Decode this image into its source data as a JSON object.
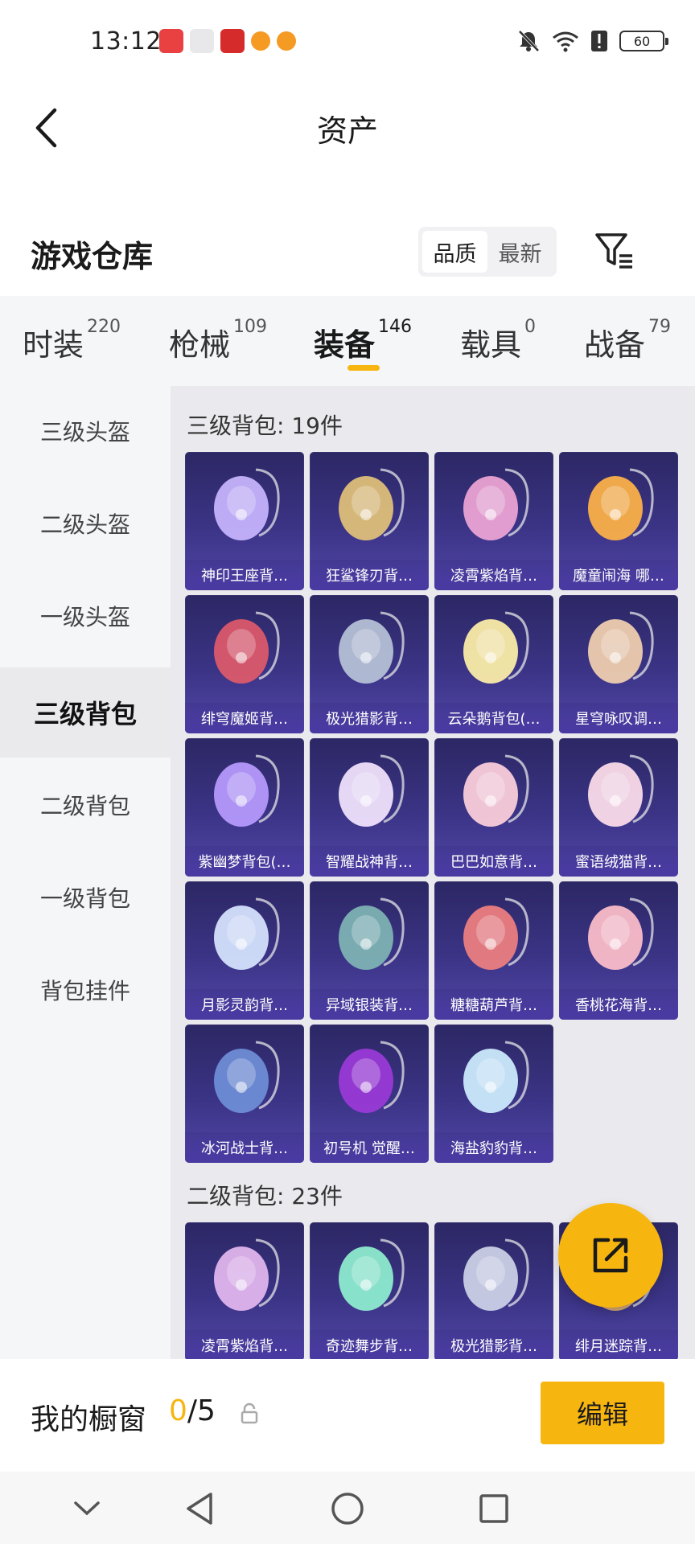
{
  "status_bar": {
    "time": "13:12",
    "battery": "60"
  },
  "header": {
    "title": "资产"
  },
  "warehouse": {
    "title": "游戏仓库",
    "sort_options": [
      {
        "label": "品质",
        "active": true
      },
      {
        "label": "最新",
        "active": false
      }
    ]
  },
  "tabs": [
    {
      "label": "时装",
      "count": "220",
      "active": false
    },
    {
      "label": "枪械",
      "count": "109",
      "active": false
    },
    {
      "label": "装备",
      "count": "146",
      "active": true
    },
    {
      "label": "载具",
      "count": "0",
      "active": false
    },
    {
      "label": "战备",
      "count": "79",
      "active": false
    }
  ],
  "sidebar": {
    "items": [
      {
        "label": "三级头盔",
        "active": false
      },
      {
        "label": "二级头盔",
        "active": false
      },
      {
        "label": "一级头盔",
        "active": false
      },
      {
        "label": "三级背包",
        "active": true
      },
      {
        "label": "二级背包",
        "active": false
      },
      {
        "label": "一级背包",
        "active": false
      },
      {
        "label": "背包挂件",
        "active": false
      }
    ]
  },
  "sections": [
    {
      "title": "三级背包: 19件",
      "items": [
        "神印王座背…",
        "狂鲨锋刃背…",
        "凌霄紫焰背…",
        "魔童闹海 哪…",
        "绯穹魔姬背…",
        "极光猎影背…",
        "云朵鹅背包(…",
        "星穹咏叹调…",
        "紫幽梦背包(…",
        "智耀战神背…",
        "巴巴如意背…",
        "蜜语绒猫背…",
        "月影灵韵背…",
        "异域银装背…",
        "糖糖葫芦背…",
        "香桃花海背…",
        "冰河战士背…",
        "初号机 觉醒…",
        "海盐豹豹背…"
      ]
    },
    {
      "title": "二级背包: 23件",
      "items": [
        "凌霄紫焰背…",
        "奇迹舞步背…",
        "极光猎影背…",
        "绯月迷踪背…"
      ]
    }
  ],
  "showcase": {
    "title": "我的橱窗",
    "current": "0",
    "max": "/5",
    "edit_label": "编辑"
  },
  "colors": {
    "accent": "#f7b50f",
    "card_bg": "#3b3486"
  }
}
